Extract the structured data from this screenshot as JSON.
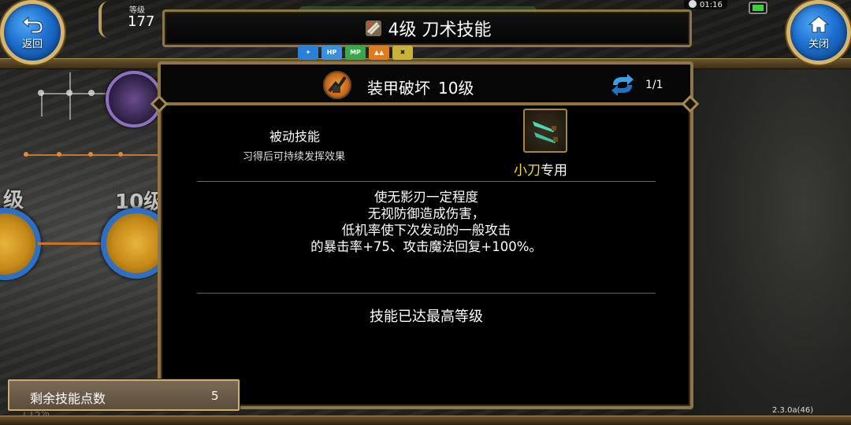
{
  "header": {
    "return_label": "返回",
    "close_label": "关闭",
    "level_caption": "等级",
    "level_value": "177",
    "time": "01:16",
    "title": "4级 刀术技能"
  },
  "buffs": [
    {
      "text": "✦",
      "color": "#2a7fd6"
    },
    {
      "text": "HP",
      "color": "#3b8fe0"
    },
    {
      "text": "MP",
      "color": "#3aa84a"
    },
    {
      "text": "▲▲",
      "color": "#e07a1e"
    },
    {
      "text": "✖",
      "color": "#c9b23a"
    }
  ],
  "background": {
    "level_left": "级",
    "level_right": "10级"
  },
  "skill": {
    "name": "装甲破坏",
    "level": "10级",
    "page": "1/1",
    "type_title": "被动技能",
    "type_desc": "习得后可持续发挥效果",
    "weapon_highlight": "小刀",
    "weapon_suffix": "专用",
    "description": [
      "使无影刃一定程度",
      "无视防御造成伤害，",
      "低机率使下次发动的一般攻击",
      "的暴击率+75、攻击魔法回复+100%。"
    ],
    "max_level_text": "技能已达最高等级"
  },
  "footer": {
    "points_label": "剩余技能点数",
    "points_value": "5",
    "version": "2.3.0a(46)"
  },
  "colors": {
    "frame_gold": "#8d7544",
    "weapon_highlight": "#f6dc3a",
    "button_blue": "#1d6fcf"
  }
}
